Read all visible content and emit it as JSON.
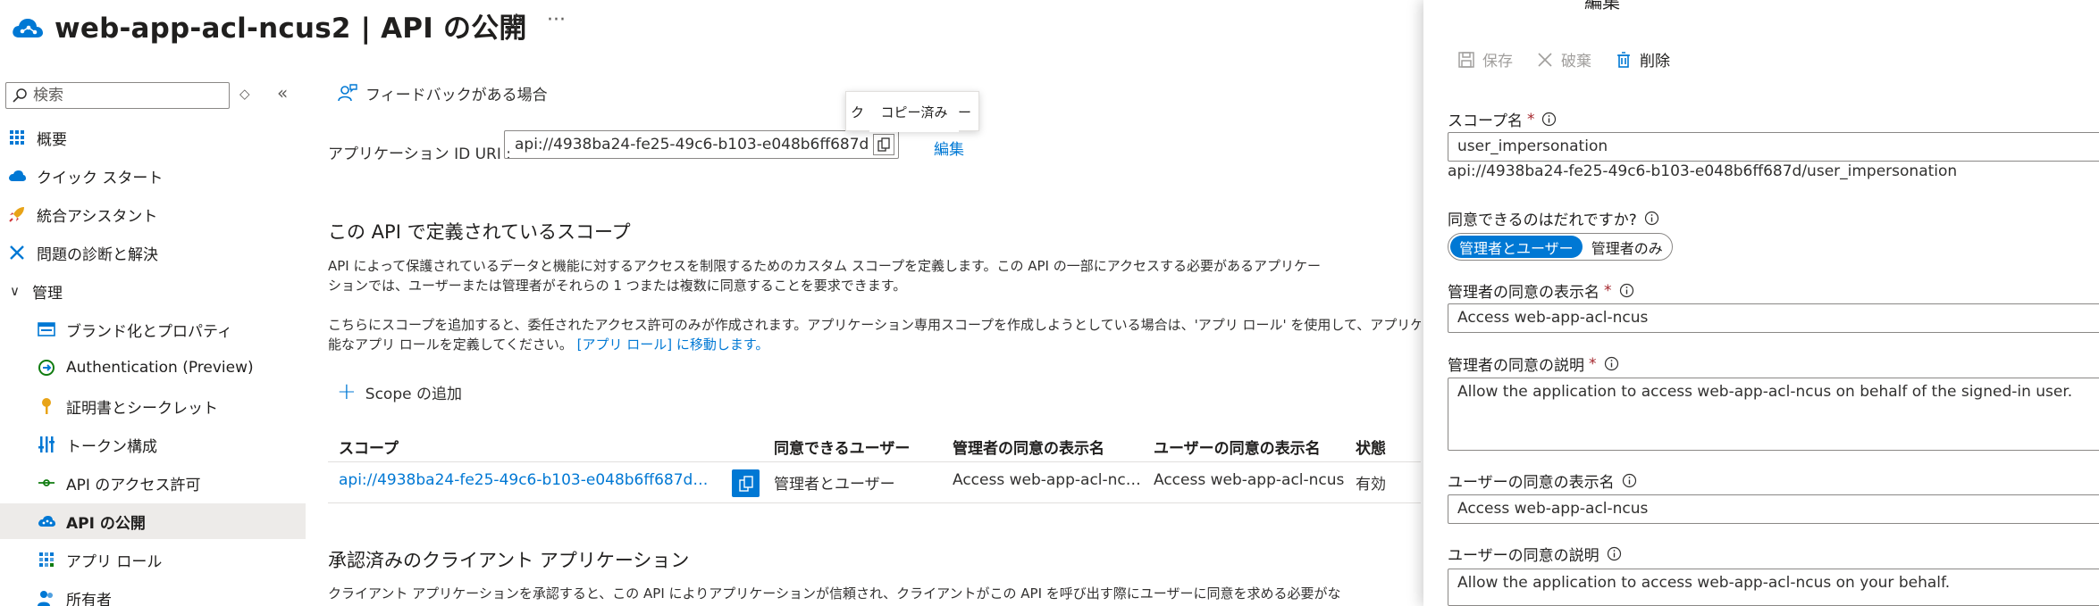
{
  "header": {
    "title": "web-app-acl-ncus2 | API の公開"
  },
  "sidebar": {
    "search_placeholder": "検索",
    "items": [
      {
        "label": "概要"
      },
      {
        "label": "クイック スタート"
      },
      {
        "label": "統合アシスタント"
      },
      {
        "label": "問題の診断と解決"
      },
      {
        "label": "管理"
      },
      {
        "label": "ブランド化とプロパティ"
      },
      {
        "label": "Authentication (Preview)"
      },
      {
        "label": "証明書とシークレット"
      },
      {
        "label": "トークン構成"
      },
      {
        "label": "API のアクセス許可"
      },
      {
        "label": "API の公開"
      },
      {
        "label": "アプリ ロール"
      },
      {
        "label": "所有者"
      }
    ]
  },
  "main": {
    "feedback_label": "フィードバックがある場合",
    "tooltip_text": "コピー済み",
    "tooltip_under": "ク",
    "tooltip_dash": "ー",
    "app_id_label": "アプリケーション ID URI :",
    "app_id_value": "api://4938ba24-fe25-49c6-b103-e048b6ff687d",
    "edit_label": "編集",
    "scopes_title": "この API で定義されているスコープ",
    "scopes_desc_1": "API によって保護されているデータと機能に対するアクセスを制限するためのカスタム スコープを定義します。この API の一部にアクセスする必要があるアプリケー",
    "scopes_desc_2": "ションでは、ユーザーまたは管理者がそれらの 1 つまたは複数に同意することを要求できます。",
    "scopes_note_1": "こちらにスコープを追加すると、委任されたアクセス許可のみが作成されます。アプリケーション専用スコープを作成しようとしている場合は、'アプリ ロール' を使用して、アプリケーションの種",
    "scopes_note_2_prefix": "能なアプリ ロールを定義してください。",
    "scopes_note_2_link": "[アプリ ロール] に移動します。",
    "add_scope_label": "Scope の追加",
    "table": {
      "headers": [
        "スコープ",
        "同意できるユーザー",
        "管理者の同意の表示名",
        "ユーザーの同意の表示名",
        "状態"
      ],
      "rows": [
        {
          "scope": "api://4938ba24-fe25-49c6-b103-e048b6ff687d…",
          "who": "管理者とユーザー",
          "admin_display": "Access web-app-acl-nc…",
          "user_display": "Access web-app-acl-ncus",
          "state": "有効"
        }
      ]
    },
    "clients_title": "承認済みのクライアント アプリケーション",
    "clients_desc": "クライアント アプリケーションを承認すると、この API によりアプリケーションが信頼され、クライアントがこの API を呼び出す際にユーザーに同意を求める必要がな"
  },
  "panel": {
    "title_cut": "編集",
    "toolbar": {
      "save": "保存",
      "discard": "破棄",
      "delete": "削除"
    },
    "scope_name_label": "スコープ名",
    "scope_name_value": "user_impersonation",
    "scope_full": "api://4938ba24-fe25-49c6-b103-e048b6ff687d/user_impersonation",
    "consent_who_label": "同意できるのはだれですか?",
    "consent_options": [
      "管理者とユーザー",
      "管理者のみ"
    ],
    "admin_display_label": "管理者の同意の表示名",
    "admin_display_value": "Access web-app-acl-ncus",
    "admin_desc_label": "管理者の同意の説明",
    "admin_desc_value": "Allow the application to access web-app-acl-ncus on behalf of the signed-in user.",
    "user_display_label": "ユーザーの同意の表示名",
    "user_display_value": "Access web-app-acl-ncus",
    "user_desc_label": "ユーザーの同意の説明",
    "user_desc_value": "Allow the application to access web-app-acl-ncus on your behalf.",
    "required_mark": "*"
  },
  "colors": {
    "accent": "#0078d4",
    "text": "#323130",
    "disabled": "#a19f9d",
    "required": "#a4262c",
    "active_nav": "#edebe9"
  }
}
